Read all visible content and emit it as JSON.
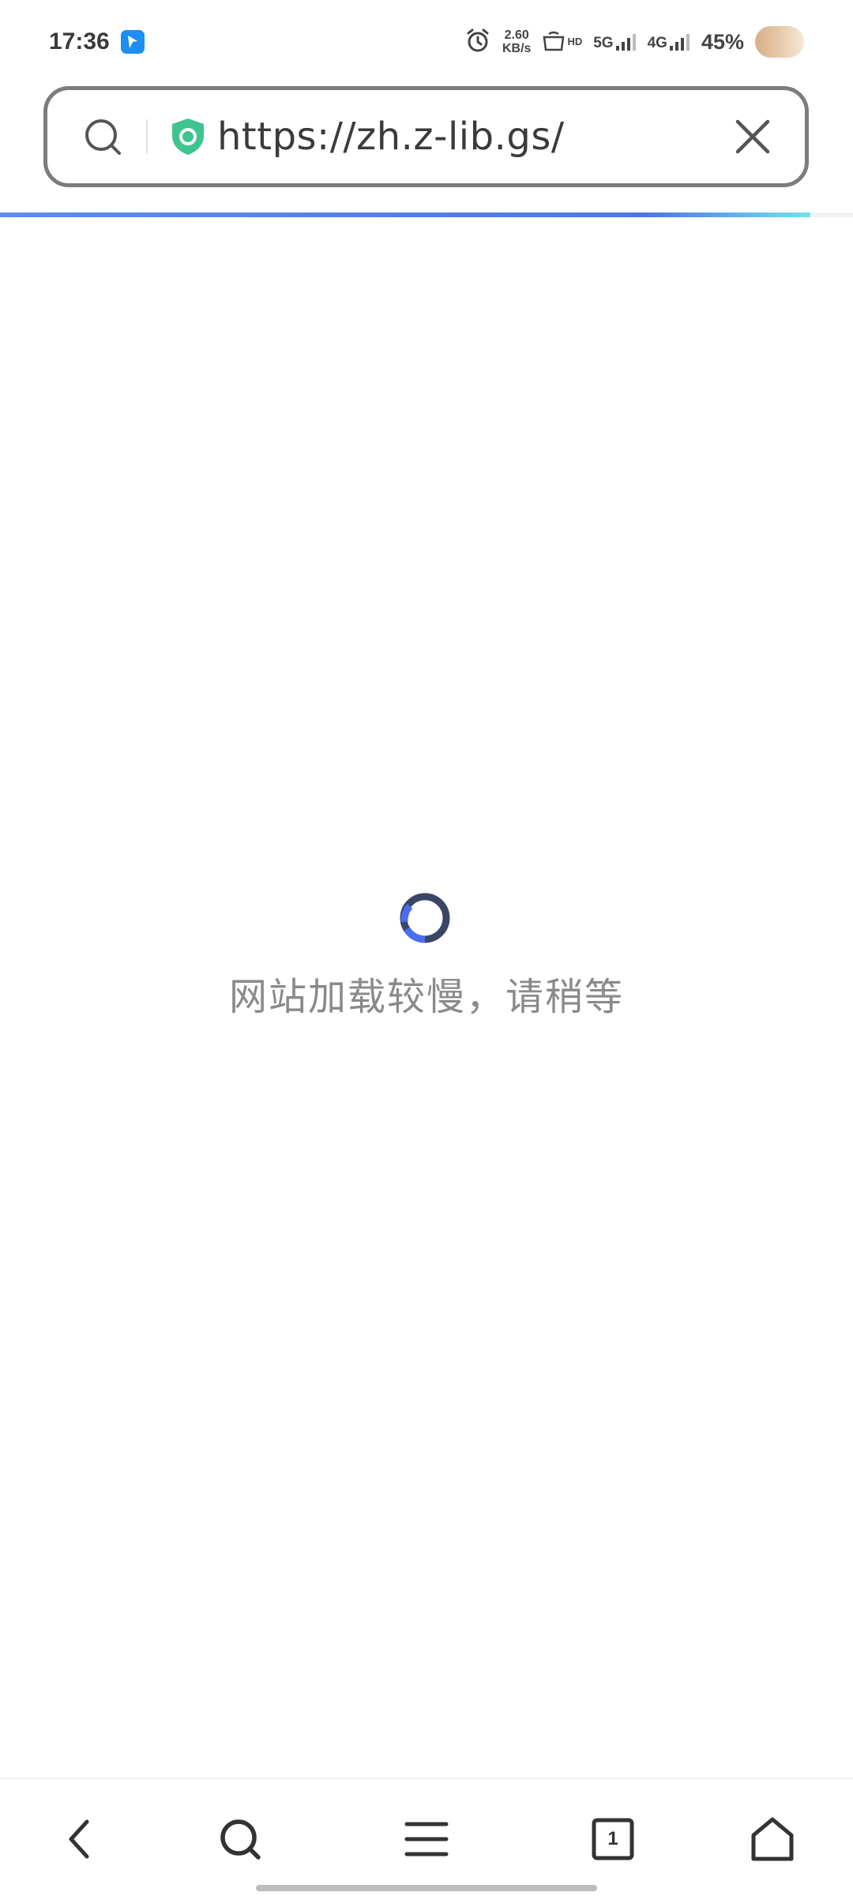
{
  "status_bar": {
    "time": "17:36",
    "net_speed_value": "2.60",
    "net_speed_unit": "KB/s",
    "hd_label": "HD",
    "sim1_network": "5G",
    "sim2_network": "4G",
    "battery": "45%",
    "icons": [
      "app-badge-icon",
      "alarm-icon",
      "hd-voice-icon",
      "signal-5g-icon",
      "signal-4g-icon",
      "avatar"
    ]
  },
  "address_bar": {
    "url": "https://zh.z-lib.gs/",
    "icons": [
      "search-icon",
      "security-shield-icon",
      "close-icon"
    ],
    "shield_color": "#3fc48e"
  },
  "progress": {
    "percent": 95
  },
  "loading": {
    "message": "网站加载较慢，请稍等"
  },
  "bottom_nav": {
    "tab_count": "1",
    "icons": [
      "back-icon",
      "search-icon",
      "menu-icon",
      "tabs-icon",
      "home-icon"
    ]
  },
  "colors": {
    "accent": "#4d76e8",
    "spinner_dark": "#3b4566",
    "spinner_light": "#4b6ef0",
    "text_muted": "#8a8a8a"
  }
}
